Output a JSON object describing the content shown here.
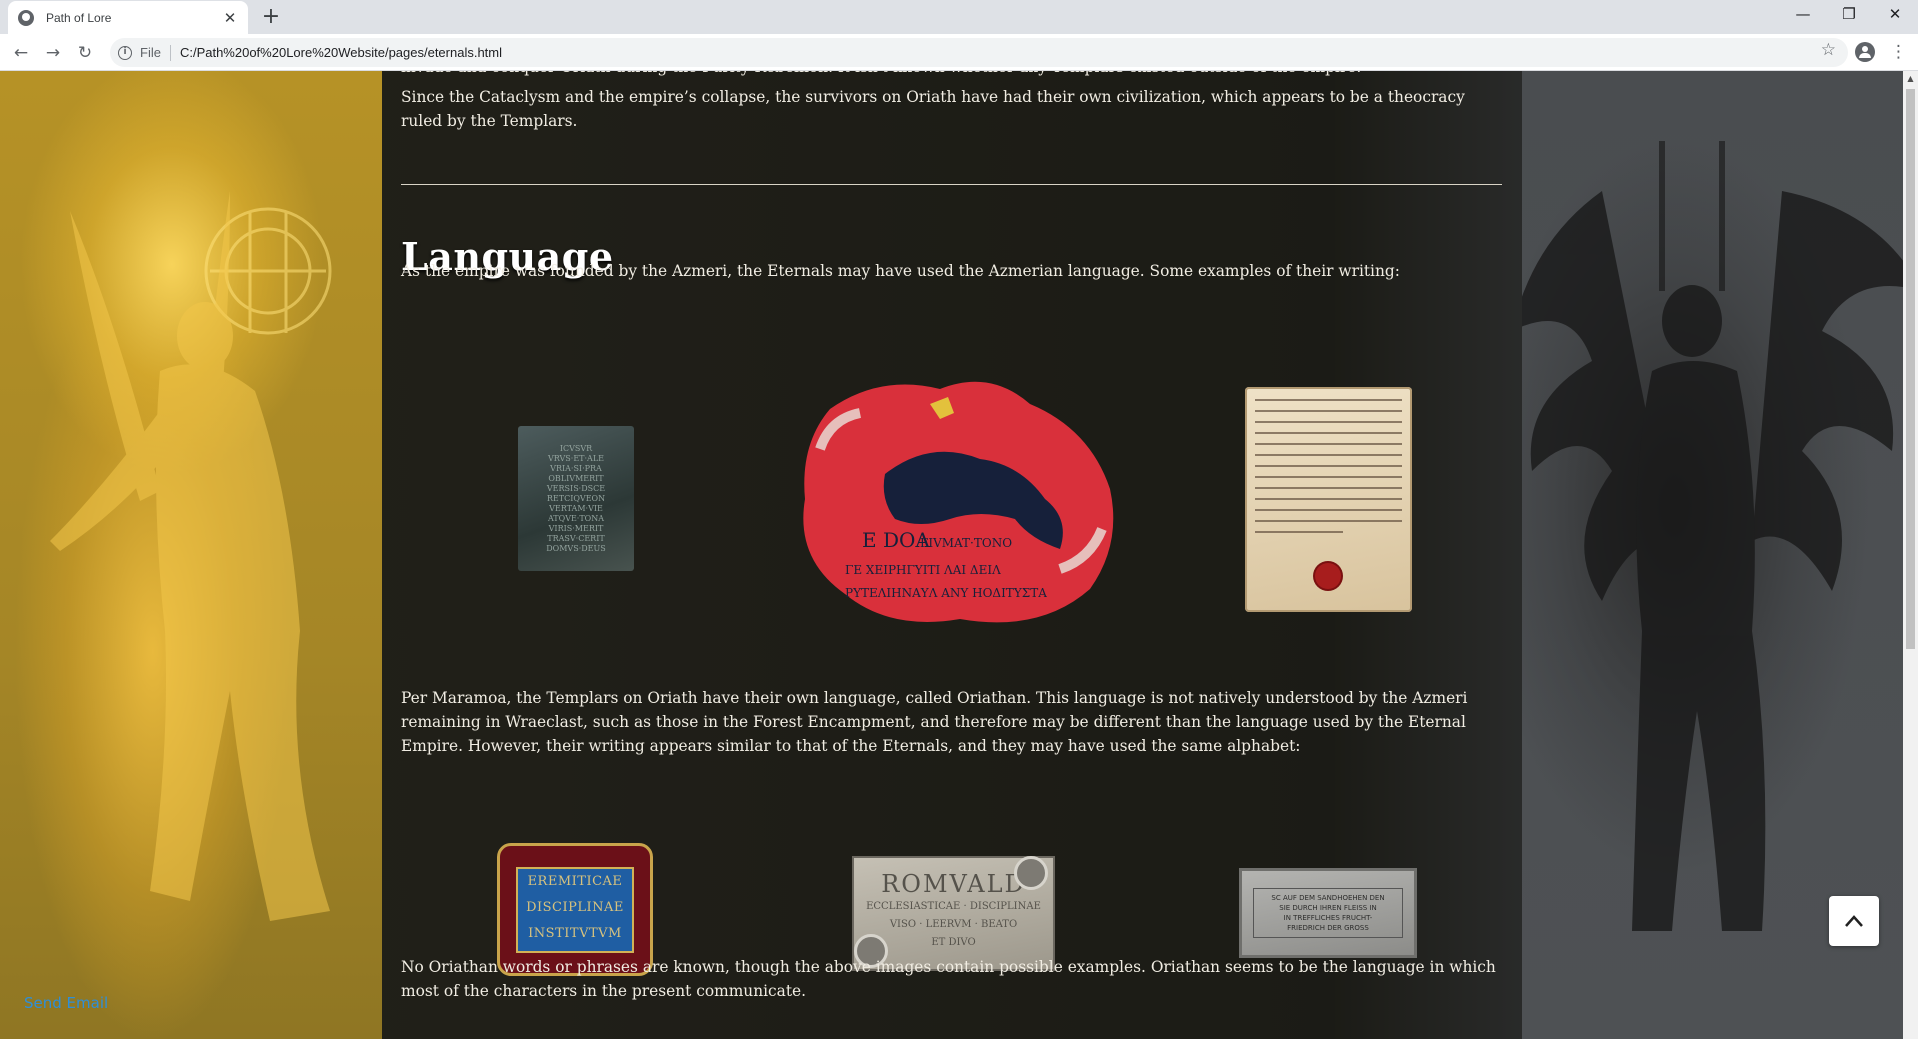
{
  "browser": {
    "tab_title": "Path of Lore",
    "tab_close": "✕",
    "new_tab": "+",
    "scheme_label": "File",
    "url": "C:/Path%20of%20Lore%20Website/pages/eternals.html",
    "window_minimize": "—",
    "window_restore": "❐",
    "window_close": "✕",
    "back": "←",
    "forward": "→",
    "reload": "↻",
    "star": "☆",
    "menu": "⋮"
  },
  "page": {
    "cut_line": "invade and conquer Oriath during the Purity Rebellion. It isn't known whether any Templars existed outside of the empire.",
    "para_oriath": "Since the Cataclysm and the empire’s collapse, the survivors on Oriath have had their own civilization, which appears to be a theocracy ruled by the Templars.",
    "heading_language": "Language",
    "para_azmeri": "As the empire was founded by the Azmeri, the Eternals may have used the Azmerian language. Some examples of their writing:",
    "para_oriathan": "Per Maramoa, the Templars on Oriath have their own language, called Oriathan. This language is not natively understood by the Azmeri remaining in Wraeclast, such as those in the Forest Encampment, and therefore may be different than the language used by the Eternal Empire. However, their writing appears similar to that of the Eternals, and they may have used the same alphabet:",
    "para_conclusion": "No Oriathan words or phrases are known, though the above images contain possible examples. Oriathan seems to be the language in which most of the characters in the present communicate.",
    "send_email": "Send Email"
  },
  "images": {
    "tablet_lines": [
      "ICVSVR",
      "VRVS·ET·ALE",
      "VRIA·SI·PRA",
      "OBLIVMERIT",
      "VERSIS·DSCE",
      "RETCIQVEON",
      "VERTAM·VIE",
      "ATQVE·TONA",
      "VIRIS·MERIT",
      "TRASV·CERIT",
      "DOMVS·DEUS"
    ],
    "fresco_text": [
      "E DOA",
      "FIVMAT·TONO",
      "ΓΕ ΧΕΙΡΗΓΥΙΤΙ ΛΑΙ ΔΕΙΛ",
      "ΡΥΤΕΛΙΗΝΑΥΛ ΑΝΥ ΗΟΔΙΤΥΣΤΑ"
    ],
    "plaque_blue_lines": [
      "EREMITICAE",
      "DISCIPLINAE",
      "INSTITVTVM"
    ],
    "plaque_stone_title": "ROMVALD",
    "plaque_stone_lines": [
      "ECCLESIASTICAE · DISCIPLINAE",
      "VISO · LEERVM · BEATO",
      "ET DIVO"
    ],
    "plaque_grey_lines": [
      "SC AUF DEM SANDHOEHEN DEN",
      "SIE DURCH IHREN FLEISS IN",
      "IN TREFFLICHES FRUCHT-",
      "FRIEDRICH DER GROSS"
    ]
  },
  "icons": {
    "favicon": "globe-icon",
    "info": "info-icon",
    "profile": "account-circle-icon",
    "back_to_top": "chevron-up-icon"
  },
  "colors": {
    "link": "#2e8fd8",
    "text": "#f1ede3",
    "left_art": "#b69226",
    "content_bg": "#22221c"
  }
}
